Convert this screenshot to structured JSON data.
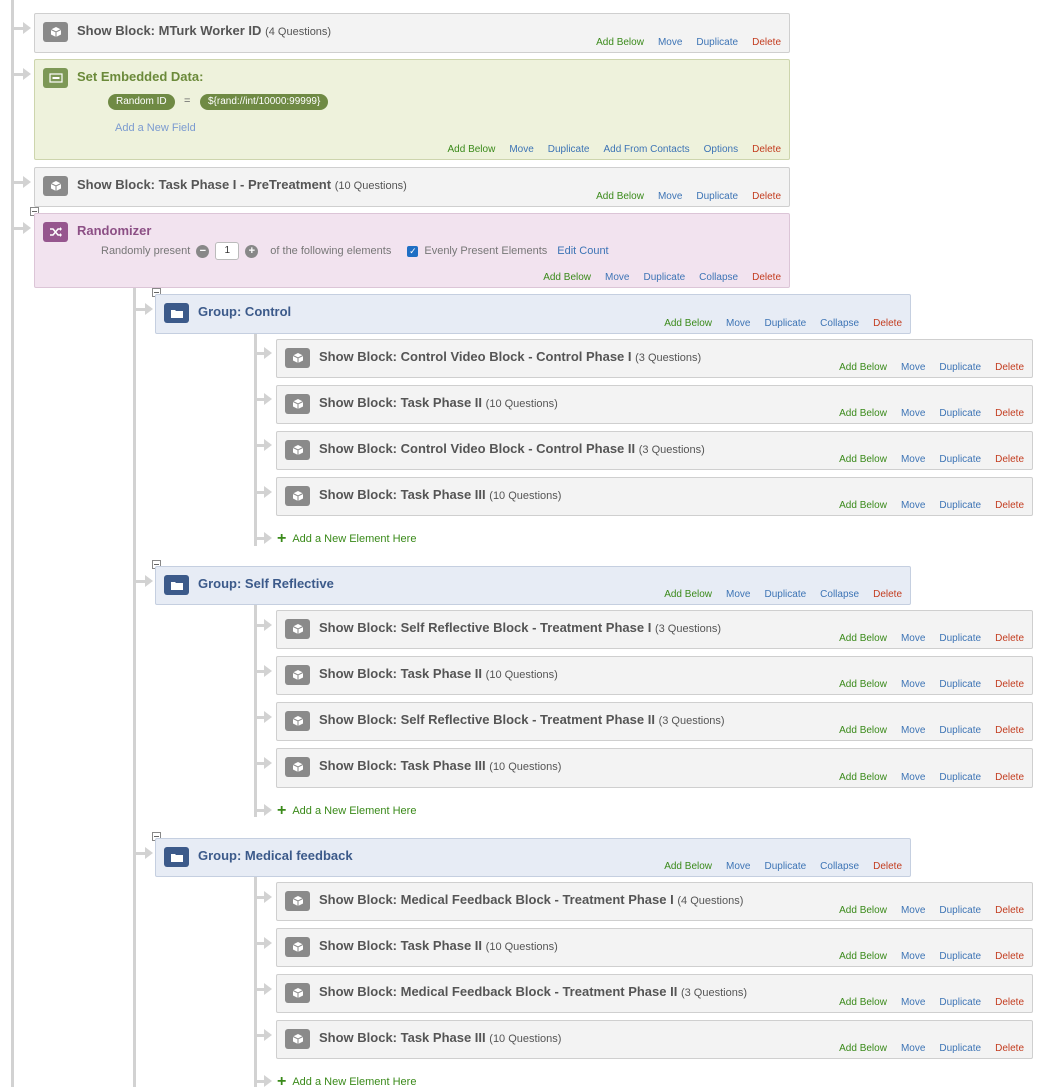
{
  "actions": {
    "add_below": "Add Below",
    "move": "Move",
    "duplicate": "Duplicate",
    "delete": "Delete",
    "collapse": "Collapse",
    "add_from_contacts": "Add From Contacts",
    "options": "Options"
  },
  "top_blocks": [
    {
      "title": "Show Block: MTurk Worker ID",
      "count": "(4 Questions)"
    }
  ],
  "embedded": {
    "title": "Set Embedded Data:",
    "field_name": "Random ID",
    "operator": "=",
    "field_value": "${rand://int/10000:99999}",
    "add_field": "Add a New Field"
  },
  "pretreatment": {
    "title": "Show Block: Task Phase I - PreTreatment",
    "count": "(10 Questions)"
  },
  "randomizer": {
    "title": "Randomizer",
    "prefix": "Randomly present",
    "count_value": "1",
    "suffix": "of the following elements",
    "evenly_label": "Evenly Present Elements",
    "edit_count": "Edit Count"
  },
  "add_new_element": "Add a New Element Here",
  "groups": [
    {
      "title": "Group: Control",
      "blocks": [
        {
          "title": "Show Block: Control Video Block - Control Phase I",
          "count": "(3 Questions)"
        },
        {
          "title": "Show Block: Task Phase II",
          "count": "(10 Questions)"
        },
        {
          "title": "Show Block: Control Video Block - Control Phase II",
          "count": "(3 Questions)"
        },
        {
          "title": "Show Block: Task Phase III",
          "count": "(10 Questions)"
        }
      ]
    },
    {
      "title": "Group: Self Reflective",
      "blocks": [
        {
          "title": "Show Block: Self Reflective Block - Treatment Phase I",
          "count": "(3 Questions)"
        },
        {
          "title": "Show Block: Task Phase II",
          "count": "(10 Questions)"
        },
        {
          "title": "Show Block: Self Reflective Block - Treatment Phase II",
          "count": "(3 Questions)"
        },
        {
          "title": "Show Block: Task Phase III",
          "count": "(10 Questions)"
        }
      ]
    },
    {
      "title": "Group: Medical feedback",
      "blocks": [
        {
          "title": "Show Block: Medical Feedback Block - Treatment Phase I",
          "count": "(4 Questions)"
        },
        {
          "title": "Show Block: Task Phase II",
          "count": "(10 Questions)"
        },
        {
          "title": "Show Block: Medical Feedback Block - Treatment Phase II",
          "count": "(3 Questions)"
        },
        {
          "title": "Show Block: Task Phase III",
          "count": "(10 Questions)"
        }
      ]
    }
  ]
}
